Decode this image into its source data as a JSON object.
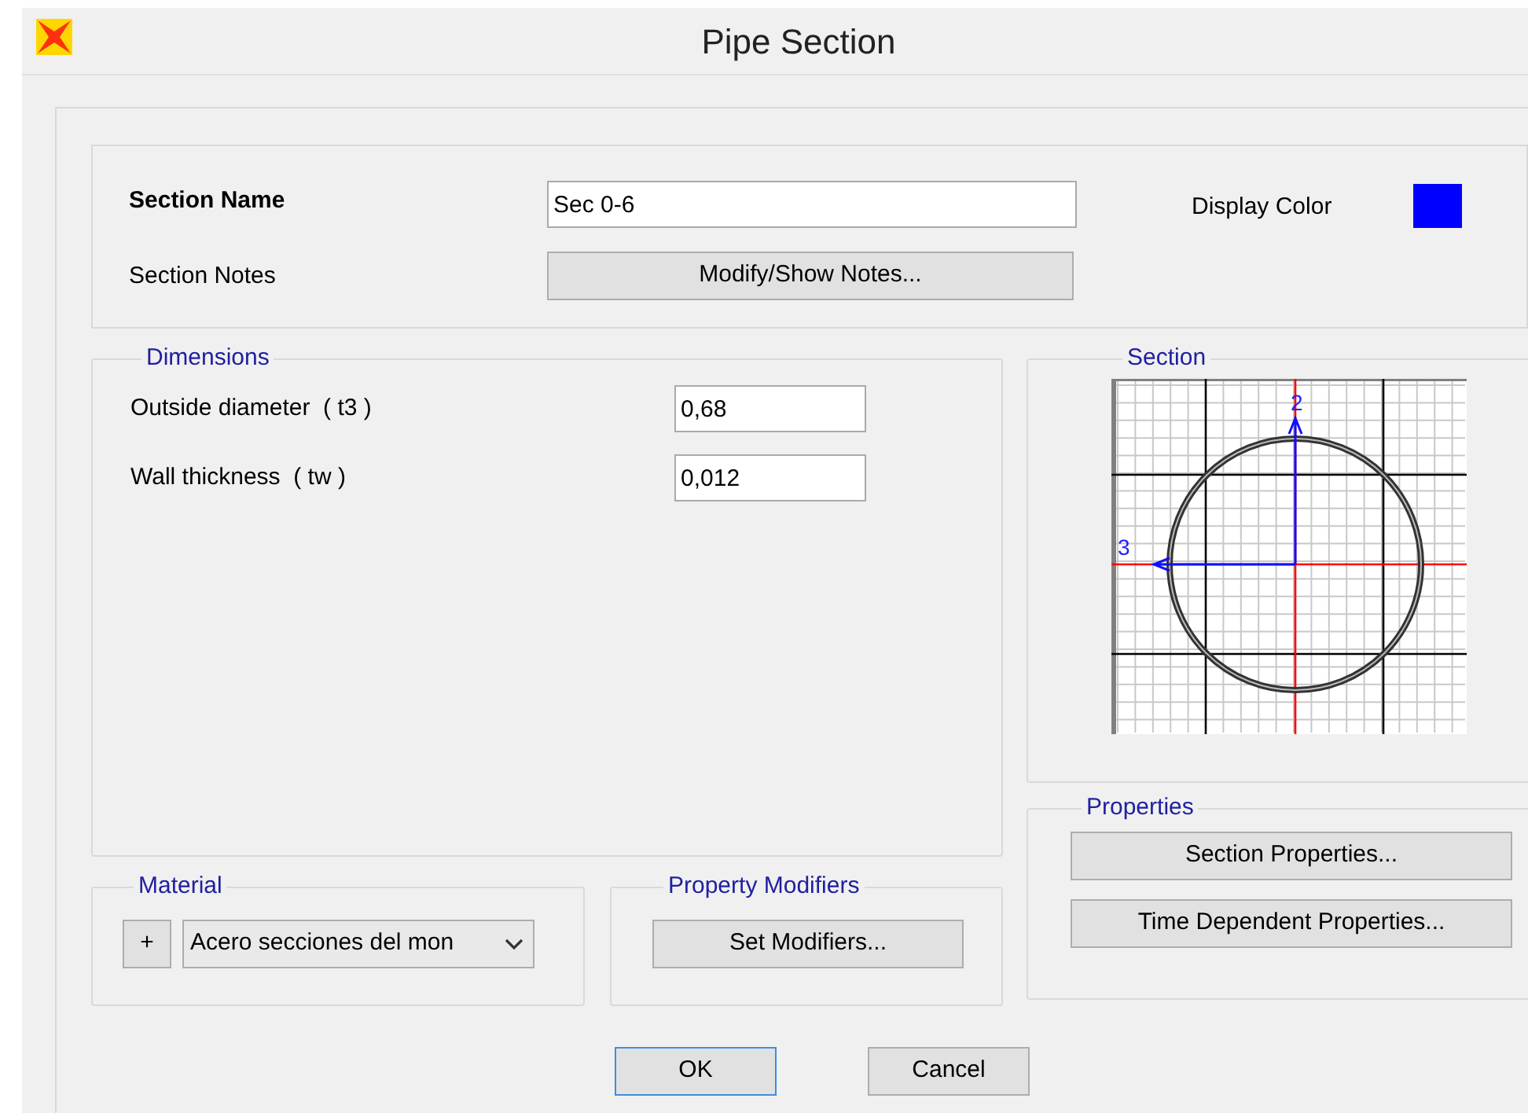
{
  "window": {
    "title": "Pipe Section"
  },
  "section_name": {
    "label": "Section Name",
    "value": "Sec 0-6"
  },
  "display_color": {
    "label": "Display Color",
    "color": "#0000ff"
  },
  "section_notes": {
    "label": "Section Notes",
    "button": "Modify/Show Notes..."
  },
  "dimensions": {
    "title": "Dimensions",
    "fields": [
      {
        "label": "Outside diameter  ( t3 )",
        "value": "0,68"
      },
      {
        "label": "Wall thickness  ( tw )",
        "value": "0,012"
      }
    ]
  },
  "section": {
    "title": "Section",
    "axis_labels": [
      "2",
      "3"
    ]
  },
  "properties": {
    "title": "Properties",
    "buttons": [
      "Section Properties...",
      "Time Dependent Properties..."
    ]
  },
  "material": {
    "title": "Material",
    "add_button": "+",
    "value": "Acero secciones del mon"
  },
  "property_modifiers": {
    "title": "Property Modifiers",
    "button": "Set Modifiers..."
  },
  "buttons": [
    {
      "label": "OK",
      "default": true
    },
    {
      "label": "Cancel",
      "default": false
    }
  ]
}
